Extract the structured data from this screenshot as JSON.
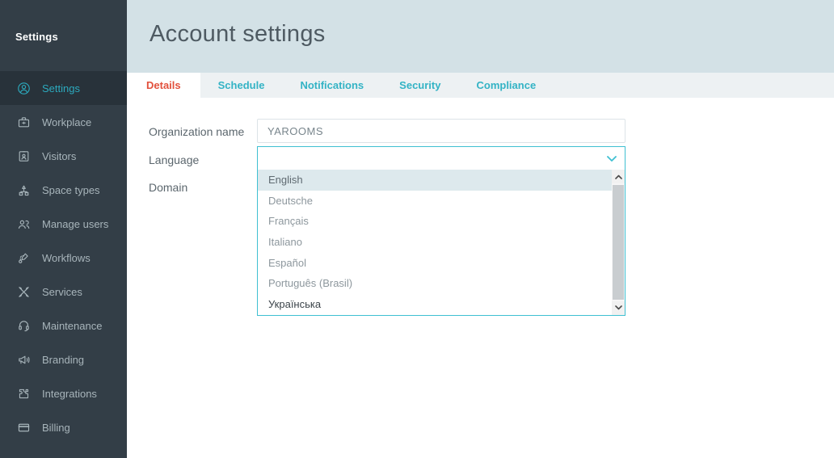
{
  "sidebar": {
    "title": "Settings",
    "items": [
      {
        "label": "Settings",
        "icon": "user-circle-icon",
        "active": true
      },
      {
        "label": "Workplace",
        "icon": "briefcase-icon",
        "active": false
      },
      {
        "label": "Visitors",
        "icon": "id-badge-icon",
        "active": false
      },
      {
        "label": "Space types",
        "icon": "hierarchy-icon",
        "active": false
      },
      {
        "label": "Manage users",
        "icon": "users-icon",
        "active": false
      },
      {
        "label": "Workflows",
        "icon": "workflow-icon",
        "active": false
      },
      {
        "label": "Services",
        "icon": "tools-icon",
        "active": false
      },
      {
        "label": "Maintenance",
        "icon": "headset-icon",
        "active": false
      },
      {
        "label": "Branding",
        "icon": "megaphone-icon",
        "active": false
      },
      {
        "label": "Integrations",
        "icon": "puzzle-icon",
        "active": false
      },
      {
        "label": "Billing",
        "icon": "credit-card-icon",
        "active": false
      }
    ]
  },
  "header": {
    "title": "Account settings"
  },
  "tabs": [
    {
      "label": "Details",
      "active": true
    },
    {
      "label": "Schedule",
      "active": false
    },
    {
      "label": "Notifications",
      "active": false
    },
    {
      "label": "Security",
      "active": false
    },
    {
      "label": "Compliance",
      "active": false
    }
  ],
  "form": {
    "organization": {
      "label": "Organization name",
      "value": "YAROOMS"
    },
    "language": {
      "label": "Language",
      "value": ""
    },
    "domain": {
      "label": "Domain"
    }
  },
  "language_dropdown": {
    "highlighted_option": "English",
    "options": [
      "English",
      "Deutsche",
      "Français",
      "Italiano",
      "Español",
      "Português (Brasil)",
      "Українська"
    ]
  },
  "colors": {
    "sidebar_bg": "#333e47",
    "sidebar_active_bg": "#28323a",
    "sidebar_text": "#a8b5bb",
    "accent_teal": "#2caabe",
    "header_bg": "#d3e1e6",
    "tabbar_bg": "#edf1f3",
    "tab_text": "#33b3c5",
    "tab_active_text": "#e2503c",
    "select_border": "#3fc0d2",
    "option_highlight_bg": "#dde9ed"
  }
}
